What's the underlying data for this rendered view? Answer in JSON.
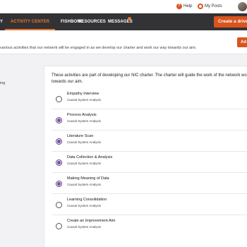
{
  "topbar": {
    "help_label": "Help",
    "posts_label": "My Posts"
  },
  "nav": {
    "items": [
      {
        "label": "Y"
      },
      {
        "label": "ACTIVITY CENTER"
      },
      {
        "label": "FISHBONE"
      },
      {
        "label": "RESOURCES"
      },
      {
        "label": "MESSAGES"
      }
    ],
    "create_label": "Create a drive",
    "colors": {
      "accent": "#e8772e",
      "nav_bg": "#333336",
      "button": "#d9541e"
    }
  },
  "description": {
    "text": "various activities that our network will be engaged in as we develop our charter and work our way towards our aim.",
    "add_label": "Ad"
  },
  "sidebar": {
    "text": "ing"
  },
  "main": {
    "intro": "These activities are part of developing our NIC charter. The charter will guide the work of the network work towards our aim.",
    "activities": [
      {
        "title": "Empathy Interview",
        "subtitle": "Causal System Analysis",
        "checked": false
      },
      {
        "title": "Process Analysis",
        "subtitle": "Causal System Analysis",
        "checked": true
      },
      {
        "title": "Literature Scan",
        "subtitle": "Causal System Analysis",
        "checked": true
      },
      {
        "title": "Data Collection & Analysis",
        "subtitle": "Causal System Analysis",
        "checked": true
      },
      {
        "title": "Making Meaning of Data",
        "subtitle": "Causal System Analysis",
        "checked": true
      },
      {
        "title": "Learning Consolidation",
        "subtitle": "Causal System Analysis",
        "checked": false
      },
      {
        "title": "Create an Improvement Aim",
        "subtitle": "Causal System Analysis",
        "checked": false
      }
    ]
  }
}
